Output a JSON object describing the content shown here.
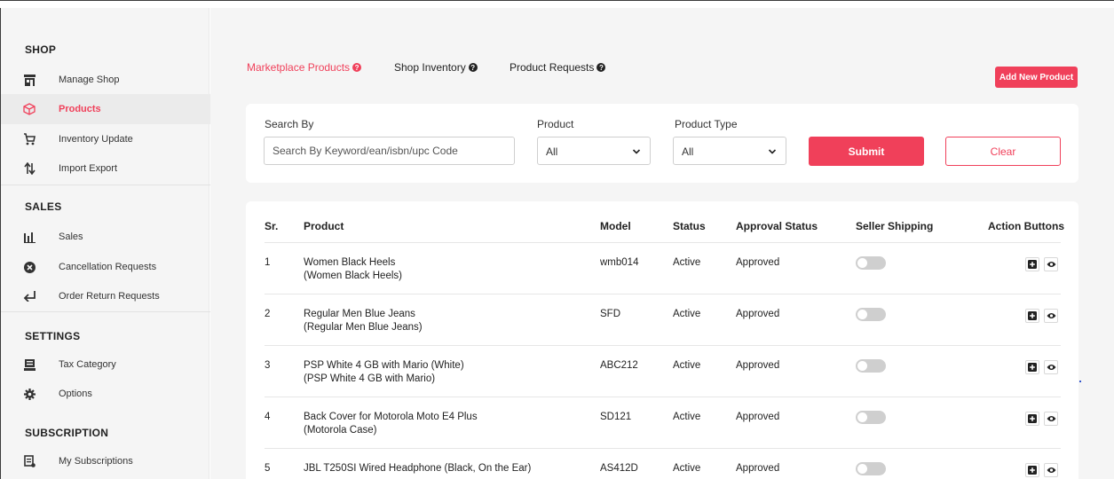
{
  "sidebar": {
    "sections": [
      {
        "title": "SHOP",
        "items": [
          {
            "label": "Manage Shop",
            "icon": "shop-icon"
          },
          {
            "label": "Products",
            "icon": "box-icon",
            "active": true
          },
          {
            "label": "Inventory Update",
            "icon": "cart-icon"
          },
          {
            "label": "Import Export",
            "icon": "import-export-icon"
          }
        ]
      },
      {
        "title": "SALES",
        "items": [
          {
            "label": "Sales",
            "icon": "bar-chart-icon"
          },
          {
            "label": "Cancellation Requests",
            "icon": "cancel-circle-icon"
          },
          {
            "label": "Order Return Requests",
            "icon": "return-arrow-icon"
          }
        ]
      },
      {
        "title": "SETTINGS",
        "items": [
          {
            "label": "Tax Category",
            "icon": "tax-icon"
          },
          {
            "label": "Options",
            "icon": "gear-icon"
          }
        ]
      },
      {
        "title": "SUBSCRIPTION",
        "items": [
          {
            "label": "My Subscriptions",
            "icon": "subscription-icon"
          }
        ]
      }
    ]
  },
  "tabs": [
    {
      "label": "Marketplace Products",
      "active": true
    },
    {
      "label": "Shop Inventory",
      "active": false
    },
    {
      "label": "Product Requests",
      "active": false
    }
  ],
  "add_button_label": "Add New Product",
  "search": {
    "search_by_label": "Search By",
    "search_placeholder": "Search By Keyword/ean/isbn/upc Code",
    "product_label": "Product",
    "product_value": "All",
    "product_type_label": "Product Type",
    "product_type_value": "All",
    "submit_label": "Submit",
    "clear_label": "Clear"
  },
  "table": {
    "headers": [
      "Sr.",
      "Product",
      "Model",
      "Status",
      "Approval Status",
      "Seller Shipping",
      "Action Buttons"
    ],
    "rows": [
      {
        "sr": "1",
        "name": "Women Black Heels",
        "sub": "(Women Black Heels)",
        "model": "wmb014",
        "status": "Active",
        "approval": "Approved"
      },
      {
        "sr": "2",
        "name": "Regular Men Blue Jeans",
        "sub": "(Regular Men Blue Jeans)",
        "model": "SFD",
        "status": "Active",
        "approval": "Approved"
      },
      {
        "sr": "3",
        "name": "PSP White 4 GB with Mario (White)",
        "sub": "(PSP White 4 GB with Mario)",
        "model": "ABC212",
        "status": "Active",
        "approval": "Approved"
      },
      {
        "sr": "4",
        "name": "Back Cover for Motorola Moto E4 Plus",
        "sub": "(Motorola Case)",
        "model": "SD121",
        "status": "Active",
        "approval": "Approved"
      },
      {
        "sr": "5",
        "name": "JBL T250SI Wired Headphone (Black, On the Ear)",
        "sub": "",
        "model": "AS412D",
        "status": "Active",
        "approval": "Approved"
      }
    ]
  },
  "colors": {
    "accent": "#f0405a",
    "sidebar_bg": "#f5f5f5",
    "card_bg": "#ffffff"
  }
}
